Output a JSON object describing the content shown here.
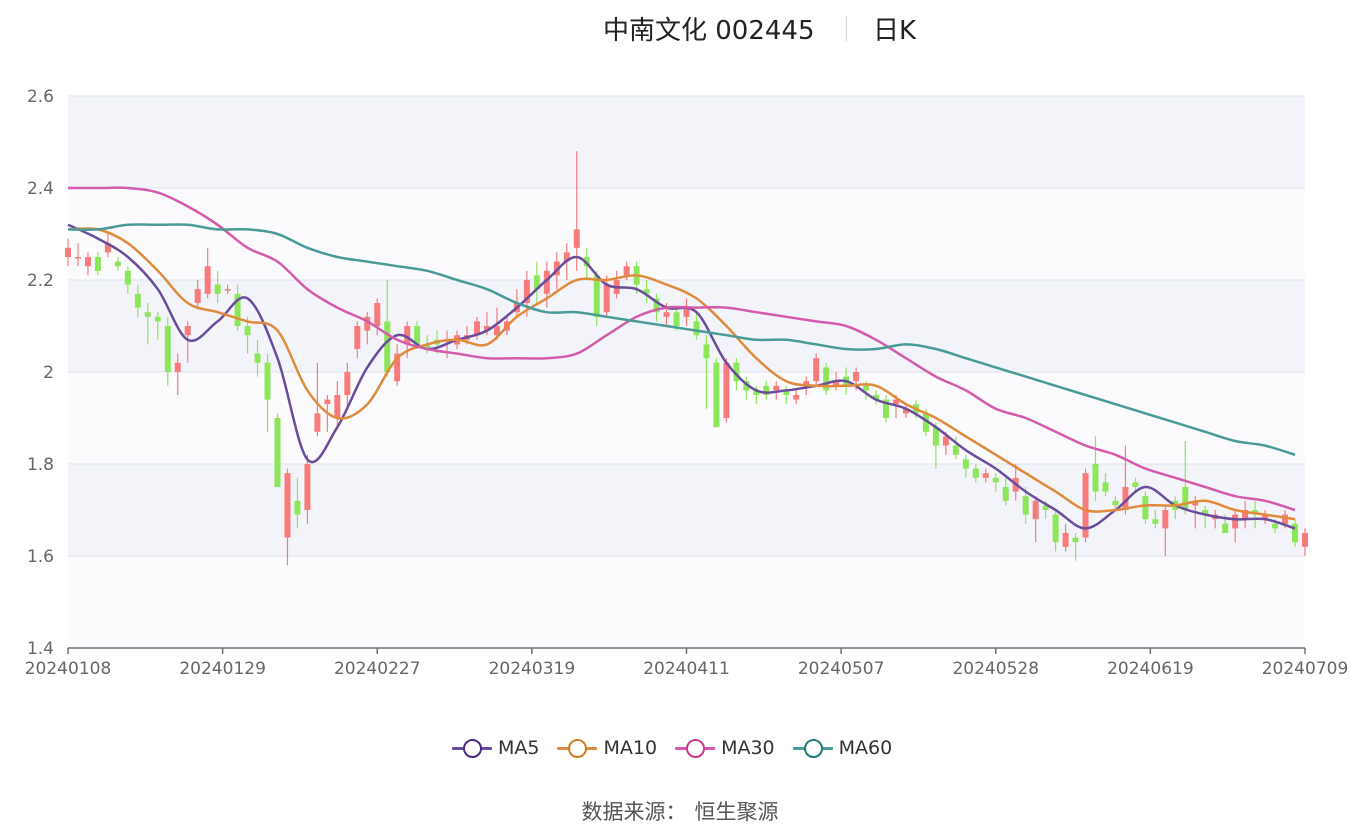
{
  "header": {
    "title": "中南文化 002445",
    "period": "日K"
  },
  "footer": {
    "source_label": "数据来源：",
    "source_name": "恒生聚源"
  },
  "chart_data": {
    "type": "candlestick",
    "x_ticks": [
      "20240108",
      "20240129",
      "20240227",
      "20240319",
      "20240411",
      "20240507",
      "20240528",
      "20240619",
      "20240709"
    ],
    "y_ticks": [
      "1.4",
      "1.6",
      "1.8",
      "2",
      "2.2",
      "2.4",
      "2.6"
    ],
    "ylim": [
      1.4,
      2.6
    ],
    "grid": true,
    "legend_position": "bottom",
    "colors": {
      "up": "#f87b7b",
      "down": "#8ce65a"
    },
    "candles": [
      [
        2.25,
        2.27,
        2.23,
        2.29
      ],
      [
        2.25,
        2.25,
        2.23,
        2.28
      ],
      [
        2.23,
        2.25,
        2.21,
        2.26
      ],
      [
        2.25,
        2.22,
        2.21,
        2.26
      ],
      [
        2.26,
        2.28,
        2.25,
        2.3
      ],
      [
        2.24,
        2.23,
        2.22,
        2.25
      ],
      [
        2.22,
        2.19,
        2.17,
        2.23
      ],
      [
        2.17,
        2.14,
        2.12,
        2.19
      ],
      [
        2.13,
        2.12,
        2.06,
        2.15
      ],
      [
        2.12,
        2.11,
        2.07,
        2.13
      ],
      [
        2.1,
        2.0,
        1.97,
        2.12
      ],
      [
        2.0,
        2.02,
        1.95,
        2.04
      ],
      [
        2.08,
        2.1,
        2.02,
        2.11
      ],
      [
        2.15,
        2.18,
        2.14,
        2.2
      ],
      [
        2.17,
        2.23,
        2.16,
        2.27
      ],
      [
        2.19,
        2.17,
        2.15,
        2.22
      ],
      [
        2.18,
        2.18,
        2.17,
        2.19
      ],
      [
        2.17,
        2.1,
        2.09,
        2.19
      ],
      [
        2.1,
        2.08,
        2.04,
        2.12
      ],
      [
        2.04,
        2.02,
        1.99,
        2.07
      ],
      [
        2.02,
        1.94,
        1.87,
        2.04
      ],
      [
        1.9,
        1.75,
        1.75,
        1.91
      ],
      [
        1.64,
        1.78,
        1.58,
        1.79
      ],
      [
        1.72,
        1.69,
        1.66,
        1.77
      ],
      [
        1.7,
        1.8,
        1.67,
        1.82
      ],
      [
        1.87,
        1.91,
        1.86,
        2.02
      ],
      [
        1.93,
        1.94,
        1.87,
        1.95
      ],
      [
        1.9,
        1.95,
        1.88,
        1.98
      ],
      [
        1.95,
        2.0,
        1.92,
        2.02
      ],
      [
        2.05,
        2.1,
        2.03,
        2.11
      ],
      [
        2.09,
        2.12,
        2.06,
        2.13
      ],
      [
        2.1,
        2.15,
        2.08,
        2.16
      ],
      [
        2.11,
        2.0,
        1.99,
        2.2
      ],
      [
        1.98,
        2.04,
        1.97,
        2.06
      ],
      [
        2.06,
        2.1,
        2.03,
        2.11
      ],
      [
        2.1,
        2.06,
        2.05,
        2.11
      ],
      [
        2.06,
        2.05,
        2.04,
        2.08
      ],
      [
        2.07,
        2.06,
        2.04,
        2.09
      ],
      [
        2.07,
        2.07,
        2.03,
        2.09
      ],
      [
        2.06,
        2.08,
        2.05,
        2.09
      ],
      [
        2.07,
        2.08,
        2.06,
        2.1
      ],
      [
        2.08,
        2.11,
        2.07,
        2.12
      ],
      [
        2.09,
        2.1,
        2.08,
        2.13
      ],
      [
        2.08,
        2.1,
        2.07,
        2.14
      ],
      [
        2.09,
        2.11,
        2.08,
        2.12
      ],
      [
        2.13,
        2.15,
        2.12,
        2.18
      ],
      [
        2.15,
        2.2,
        2.12,
        2.22
      ],
      [
        2.21,
        2.18,
        2.15,
        2.24
      ],
      [
        2.17,
        2.22,
        2.14,
        2.24
      ],
      [
        2.21,
        2.24,
        2.18,
        2.26
      ],
      [
        2.24,
        2.26,
        2.2,
        2.28
      ],
      [
        2.27,
        2.31,
        2.22,
        2.48
      ],
      [
        2.25,
        2.23,
        2.2,
        2.27
      ],
      [
        2.21,
        2.12,
        2.1,
        2.22
      ],
      [
        2.13,
        2.19,
        2.12,
        2.21
      ],
      [
        2.17,
        2.2,
        2.16,
        2.22
      ],
      [
        2.21,
        2.23,
        2.2,
        2.24
      ],
      [
        2.23,
        2.19,
        2.17,
        2.24
      ],
      [
        2.18,
        2.17,
        2.15,
        2.2
      ],
      [
        2.16,
        2.13,
        2.11,
        2.17
      ],
      [
        2.12,
        2.13,
        2.1,
        2.15
      ],
      [
        2.13,
        2.1,
        2.09,
        2.14
      ],
      [
        2.12,
        2.14,
        2.1,
        2.16
      ],
      [
        2.11,
        2.08,
        2.07,
        2.13
      ],
      [
        2.06,
        2.03,
        1.92,
        2.08
      ],
      [
        2.02,
        1.88,
        1.88,
        2.03
      ],
      [
        1.9,
        2.02,
        1.89,
        2.03
      ],
      [
        2.02,
        1.98,
        1.96,
        2.03
      ],
      [
        1.98,
        1.96,
        1.94,
        1.99
      ],
      [
        1.96,
        1.95,
        1.93,
        1.97
      ],
      [
        1.97,
        1.95,
        1.94,
        1.98
      ],
      [
        1.96,
        1.97,
        1.94,
        1.98
      ],
      [
        1.96,
        1.95,
        1.93,
        1.97
      ],
      [
        1.94,
        1.95,
        1.93,
        1.96
      ],
      [
        1.97,
        1.98,
        1.95,
        1.99
      ],
      [
        1.98,
        2.03,
        1.97,
        2.04
      ],
      [
        2.01,
        1.96,
        1.95,
        2.02
      ],
      [
        1.97,
        1.98,
        1.96,
        2.0
      ],
      [
        1.99,
        1.97,
        1.95,
        2.01
      ],
      [
        1.98,
        2.0,
        1.96,
        2.01
      ],
      [
        1.97,
        1.96,
        1.94,
        1.98
      ],
      [
        1.95,
        1.94,
        1.93,
        1.96
      ],
      [
        1.94,
        1.9,
        1.89,
        1.95
      ],
      [
        1.93,
        1.94,
        1.9,
        1.95
      ],
      [
        1.91,
        1.92,
        1.9,
        1.93
      ],
      [
        1.93,
        1.91,
        1.9,
        1.94
      ],
      [
        1.91,
        1.87,
        1.86,
        1.92
      ],
      [
        1.88,
        1.84,
        1.79,
        1.89
      ],
      [
        1.84,
        1.86,
        1.82,
        1.87
      ],
      [
        1.84,
        1.82,
        1.81,
        1.86
      ],
      [
        1.81,
        1.79,
        1.77,
        1.82
      ],
      [
        1.79,
        1.77,
        1.76,
        1.8
      ],
      [
        1.77,
        1.78,
        1.76,
        1.79
      ],
      [
        1.77,
        1.76,
        1.74,
        1.78
      ],
      [
        1.75,
        1.72,
        1.71,
        1.77
      ],
      [
        1.74,
        1.77,
        1.72,
        1.8
      ],
      [
        1.73,
        1.69,
        1.67,
        1.75
      ],
      [
        1.68,
        1.72,
        1.63,
        1.73
      ],
      [
        1.71,
        1.7,
        1.68,
        1.72
      ],
      [
        1.69,
        1.63,
        1.61,
        1.7
      ],
      [
        1.62,
        1.65,
        1.61,
        1.67
      ],
      [
        1.64,
        1.63,
        1.59,
        1.65
      ],
      [
        1.64,
        1.78,
        1.63,
        1.79
      ],
      [
        1.8,
        1.74,
        1.72,
        1.86
      ],
      [
        1.76,
        1.74,
        1.73,
        1.78
      ],
      [
        1.72,
        1.71,
        1.7,
        1.73
      ],
      [
        1.7,
        1.75,
        1.69,
        1.84
      ],
      [
        1.76,
        1.75,
        1.74,
        1.77
      ],
      [
        1.73,
        1.68,
        1.67,
        1.74
      ],
      [
        1.68,
        1.67,
        1.66,
        1.7
      ],
      [
        1.66,
        1.7,
        1.6,
        1.71
      ],
      [
        1.72,
        1.7,
        1.68,
        1.73
      ],
      [
        1.75,
        1.7,
        1.69,
        1.85
      ],
      [
        1.71,
        1.72,
        1.66,
        1.73
      ],
      [
        1.7,
        1.69,
        1.66,
        1.71
      ],
      [
        1.68,
        1.69,
        1.66,
        1.7
      ],
      [
        1.67,
        1.65,
        1.65,
        1.69
      ],
      [
        1.66,
        1.69,
        1.63,
        1.7
      ],
      [
        1.68,
        1.7,
        1.66,
        1.72
      ],
      [
        1.7,
        1.69,
        1.66,
        1.72
      ],
      [
        1.68,
        1.69,
        1.67,
        1.7
      ],
      [
        1.67,
        1.66,
        1.65,
        1.68
      ],
      [
        1.67,
        1.69,
        1.66,
        1.7
      ],
      [
        1.67,
        1.63,
        1.62,
        1.68
      ],
      [
        1.62,
        1.65,
        1.6,
        1.66
      ]
    ],
    "series": [
      {
        "name": "MA5",
        "color": "#6a4c9c",
        "values": [
          [
            0,
            2.32
          ],
          [
            3,
            2.29
          ],
          [
            6,
            2.25
          ],
          [
            9,
            2.18
          ],
          [
            12,
            2.07
          ],
          [
            15,
            2.11
          ],
          [
            18,
            2.16
          ],
          [
            21,
            2.03
          ],
          [
            24,
            1.81
          ],
          [
            27,
            1.88
          ],
          [
            30,
            2.01
          ],
          [
            33,
            2.08
          ],
          [
            36,
            2.05
          ],
          [
            39,
            2.07
          ],
          [
            42,
            2.09
          ],
          [
            45,
            2.14
          ],
          [
            48,
            2.2
          ],
          [
            51,
            2.25
          ],
          [
            54,
            2.19
          ],
          [
            57,
            2.18
          ],
          [
            60,
            2.14
          ],
          [
            63,
            2.13
          ],
          [
            66,
            2.02
          ],
          [
            69,
            1.96
          ],
          [
            72,
            1.96
          ],
          [
            75,
            1.97
          ],
          [
            78,
            1.98
          ],
          [
            81,
            1.94
          ],
          [
            84,
            1.92
          ],
          [
            87,
            1.88
          ],
          [
            90,
            1.83
          ],
          [
            93,
            1.79
          ],
          [
            96,
            1.74
          ],
          [
            99,
            1.7
          ],
          [
            102,
            1.66
          ],
          [
            105,
            1.7
          ],
          [
            108,
            1.75
          ],
          [
            111,
            1.71
          ],
          [
            114,
            1.69
          ],
          [
            117,
            1.68
          ],
          [
            120,
            1.68
          ],
          [
            123,
            1.66
          ]
        ]
      },
      {
        "name": "MA10",
        "color": "#e08a3c",
        "values": [
          [
            0,
            2.31
          ],
          [
            3,
            2.31
          ],
          [
            6,
            2.28
          ],
          [
            9,
            2.22
          ],
          [
            12,
            2.15
          ],
          [
            15,
            2.13
          ],
          [
            18,
            2.11
          ],
          [
            21,
            2.09
          ],
          [
            24,
            1.96
          ],
          [
            27,
            1.9
          ],
          [
            30,
            1.93
          ],
          [
            33,
            2.03
          ],
          [
            36,
            2.06
          ],
          [
            39,
            2.07
          ],
          [
            42,
            2.06
          ],
          [
            45,
            2.12
          ],
          [
            48,
            2.16
          ],
          [
            51,
            2.2
          ],
          [
            54,
            2.2
          ],
          [
            57,
            2.21
          ],
          [
            60,
            2.19
          ],
          [
            63,
            2.16
          ],
          [
            66,
            2.1
          ],
          [
            69,
            2.03
          ],
          [
            72,
            1.98
          ],
          [
            75,
            1.97
          ],
          [
            78,
            1.97
          ],
          [
            81,
            1.97
          ],
          [
            84,
            1.93
          ],
          [
            87,
            1.9
          ],
          [
            90,
            1.86
          ],
          [
            93,
            1.82
          ],
          [
            96,
            1.78
          ],
          [
            99,
            1.74
          ],
          [
            102,
            1.7
          ],
          [
            105,
            1.7
          ],
          [
            108,
            1.71
          ],
          [
            111,
            1.71
          ],
          [
            114,
            1.72
          ],
          [
            117,
            1.7
          ],
          [
            120,
            1.69
          ],
          [
            123,
            1.68
          ]
        ]
      },
      {
        "name": "MA30",
        "color": "#d45bab",
        "values": [
          [
            0,
            2.4
          ],
          [
            3,
            2.4
          ],
          [
            6,
            2.4
          ],
          [
            9,
            2.39
          ],
          [
            12,
            2.36
          ],
          [
            15,
            2.32
          ],
          [
            18,
            2.27
          ],
          [
            21,
            2.24
          ],
          [
            24,
            2.18
          ],
          [
            27,
            2.14
          ],
          [
            30,
            2.11
          ],
          [
            33,
            2.07
          ],
          [
            36,
            2.05
          ],
          [
            39,
            2.04
          ],
          [
            42,
            2.03
          ],
          [
            45,
            2.03
          ],
          [
            48,
            2.03
          ],
          [
            51,
            2.04
          ],
          [
            54,
            2.08
          ],
          [
            57,
            2.12
          ],
          [
            60,
            2.14
          ],
          [
            63,
            2.14
          ],
          [
            66,
            2.14
          ],
          [
            69,
            2.13
          ],
          [
            72,
            2.12
          ],
          [
            75,
            2.11
          ],
          [
            78,
            2.1
          ],
          [
            81,
            2.07
          ],
          [
            84,
            2.03
          ],
          [
            87,
            1.99
          ],
          [
            90,
            1.96
          ],
          [
            93,
            1.92
          ],
          [
            96,
            1.9
          ],
          [
            99,
            1.87
          ],
          [
            102,
            1.84
          ],
          [
            105,
            1.82
          ],
          [
            108,
            1.79
          ],
          [
            111,
            1.77
          ],
          [
            114,
            1.75
          ],
          [
            117,
            1.73
          ],
          [
            120,
            1.72
          ],
          [
            123,
            1.7
          ]
        ]
      },
      {
        "name": "MA60",
        "color": "#4a9b97",
        "values": [
          [
            0,
            2.31
          ],
          [
            3,
            2.31
          ],
          [
            6,
            2.32
          ],
          [
            9,
            2.32
          ],
          [
            12,
            2.32
          ],
          [
            15,
            2.31
          ],
          [
            18,
            2.31
          ],
          [
            21,
            2.3
          ],
          [
            24,
            2.27
          ],
          [
            27,
            2.25
          ],
          [
            30,
            2.24
          ],
          [
            33,
            2.23
          ],
          [
            36,
            2.22
          ],
          [
            39,
            2.2
          ],
          [
            42,
            2.18
          ],
          [
            45,
            2.15
          ],
          [
            48,
            2.13
          ],
          [
            51,
            2.13
          ],
          [
            54,
            2.12
          ],
          [
            57,
            2.11
          ],
          [
            60,
            2.1
          ],
          [
            63,
            2.09
          ],
          [
            66,
            2.08
          ],
          [
            69,
            2.07
          ],
          [
            72,
            2.07
          ],
          [
            75,
            2.06
          ],
          [
            78,
            2.05
          ],
          [
            81,
            2.05
          ],
          [
            84,
            2.06
          ],
          [
            87,
            2.05
          ],
          [
            90,
            2.03
          ],
          [
            93,
            2.01
          ],
          [
            96,
            1.99
          ],
          [
            99,
            1.97
          ],
          [
            102,
            1.95
          ],
          [
            105,
            1.93
          ],
          [
            108,
            1.91
          ],
          [
            111,
            1.89
          ],
          [
            114,
            1.87
          ],
          [
            117,
            1.85
          ],
          [
            120,
            1.84
          ],
          [
            123,
            1.82
          ]
        ]
      }
    ]
  }
}
